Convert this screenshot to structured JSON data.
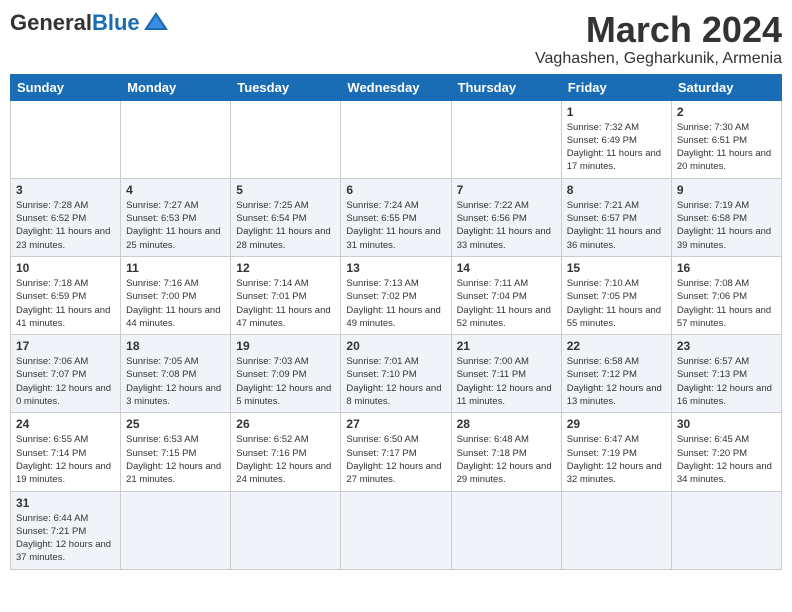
{
  "header": {
    "logo_general": "General",
    "logo_blue": "Blue",
    "month_title": "March 2024",
    "subtitle": "Vaghashen, Gegharkunik, Armenia"
  },
  "weekdays": [
    "Sunday",
    "Monday",
    "Tuesday",
    "Wednesday",
    "Thursday",
    "Friday",
    "Saturday"
  ],
  "weeks": [
    [
      {
        "date": "",
        "info": ""
      },
      {
        "date": "",
        "info": ""
      },
      {
        "date": "",
        "info": ""
      },
      {
        "date": "",
        "info": ""
      },
      {
        "date": "",
        "info": ""
      },
      {
        "date": "1",
        "info": "Sunrise: 7:32 AM\nSunset: 6:49 PM\nDaylight: 11 hours and 17 minutes."
      },
      {
        "date": "2",
        "info": "Sunrise: 7:30 AM\nSunset: 6:51 PM\nDaylight: 11 hours and 20 minutes."
      }
    ],
    [
      {
        "date": "3",
        "info": "Sunrise: 7:28 AM\nSunset: 6:52 PM\nDaylight: 11 hours and 23 minutes."
      },
      {
        "date": "4",
        "info": "Sunrise: 7:27 AM\nSunset: 6:53 PM\nDaylight: 11 hours and 25 minutes."
      },
      {
        "date": "5",
        "info": "Sunrise: 7:25 AM\nSunset: 6:54 PM\nDaylight: 11 hours and 28 minutes."
      },
      {
        "date": "6",
        "info": "Sunrise: 7:24 AM\nSunset: 6:55 PM\nDaylight: 11 hours and 31 minutes."
      },
      {
        "date": "7",
        "info": "Sunrise: 7:22 AM\nSunset: 6:56 PM\nDaylight: 11 hours and 33 minutes."
      },
      {
        "date": "8",
        "info": "Sunrise: 7:21 AM\nSunset: 6:57 PM\nDaylight: 11 hours and 36 minutes."
      },
      {
        "date": "9",
        "info": "Sunrise: 7:19 AM\nSunset: 6:58 PM\nDaylight: 11 hours and 39 minutes."
      }
    ],
    [
      {
        "date": "10",
        "info": "Sunrise: 7:18 AM\nSunset: 6:59 PM\nDaylight: 11 hours and 41 minutes."
      },
      {
        "date": "11",
        "info": "Sunrise: 7:16 AM\nSunset: 7:00 PM\nDaylight: 11 hours and 44 minutes."
      },
      {
        "date": "12",
        "info": "Sunrise: 7:14 AM\nSunset: 7:01 PM\nDaylight: 11 hours and 47 minutes."
      },
      {
        "date": "13",
        "info": "Sunrise: 7:13 AM\nSunset: 7:02 PM\nDaylight: 11 hours and 49 minutes."
      },
      {
        "date": "14",
        "info": "Sunrise: 7:11 AM\nSunset: 7:04 PM\nDaylight: 11 hours and 52 minutes."
      },
      {
        "date": "15",
        "info": "Sunrise: 7:10 AM\nSunset: 7:05 PM\nDaylight: 11 hours and 55 minutes."
      },
      {
        "date": "16",
        "info": "Sunrise: 7:08 AM\nSunset: 7:06 PM\nDaylight: 11 hours and 57 minutes."
      }
    ],
    [
      {
        "date": "17",
        "info": "Sunrise: 7:06 AM\nSunset: 7:07 PM\nDaylight: 12 hours and 0 minutes."
      },
      {
        "date": "18",
        "info": "Sunrise: 7:05 AM\nSunset: 7:08 PM\nDaylight: 12 hours and 3 minutes."
      },
      {
        "date": "19",
        "info": "Sunrise: 7:03 AM\nSunset: 7:09 PM\nDaylight: 12 hours and 5 minutes."
      },
      {
        "date": "20",
        "info": "Sunrise: 7:01 AM\nSunset: 7:10 PM\nDaylight: 12 hours and 8 minutes."
      },
      {
        "date": "21",
        "info": "Sunrise: 7:00 AM\nSunset: 7:11 PM\nDaylight: 12 hours and 11 minutes."
      },
      {
        "date": "22",
        "info": "Sunrise: 6:58 AM\nSunset: 7:12 PM\nDaylight: 12 hours and 13 minutes."
      },
      {
        "date": "23",
        "info": "Sunrise: 6:57 AM\nSunset: 7:13 PM\nDaylight: 12 hours and 16 minutes."
      }
    ],
    [
      {
        "date": "24",
        "info": "Sunrise: 6:55 AM\nSunset: 7:14 PM\nDaylight: 12 hours and 19 minutes."
      },
      {
        "date": "25",
        "info": "Sunrise: 6:53 AM\nSunset: 7:15 PM\nDaylight: 12 hours and 21 minutes."
      },
      {
        "date": "26",
        "info": "Sunrise: 6:52 AM\nSunset: 7:16 PM\nDaylight: 12 hours and 24 minutes."
      },
      {
        "date": "27",
        "info": "Sunrise: 6:50 AM\nSunset: 7:17 PM\nDaylight: 12 hours and 27 minutes."
      },
      {
        "date": "28",
        "info": "Sunrise: 6:48 AM\nSunset: 7:18 PM\nDaylight: 12 hours and 29 minutes."
      },
      {
        "date": "29",
        "info": "Sunrise: 6:47 AM\nSunset: 7:19 PM\nDaylight: 12 hours and 32 minutes."
      },
      {
        "date": "30",
        "info": "Sunrise: 6:45 AM\nSunset: 7:20 PM\nDaylight: 12 hours and 34 minutes."
      }
    ],
    [
      {
        "date": "31",
        "info": "Sunrise: 6:44 AM\nSunset: 7:21 PM\nDaylight: 12 hours and 37 minutes."
      },
      {
        "date": "",
        "info": ""
      },
      {
        "date": "",
        "info": ""
      },
      {
        "date": "",
        "info": ""
      },
      {
        "date": "",
        "info": ""
      },
      {
        "date": "",
        "info": ""
      },
      {
        "date": "",
        "info": ""
      }
    ]
  ]
}
